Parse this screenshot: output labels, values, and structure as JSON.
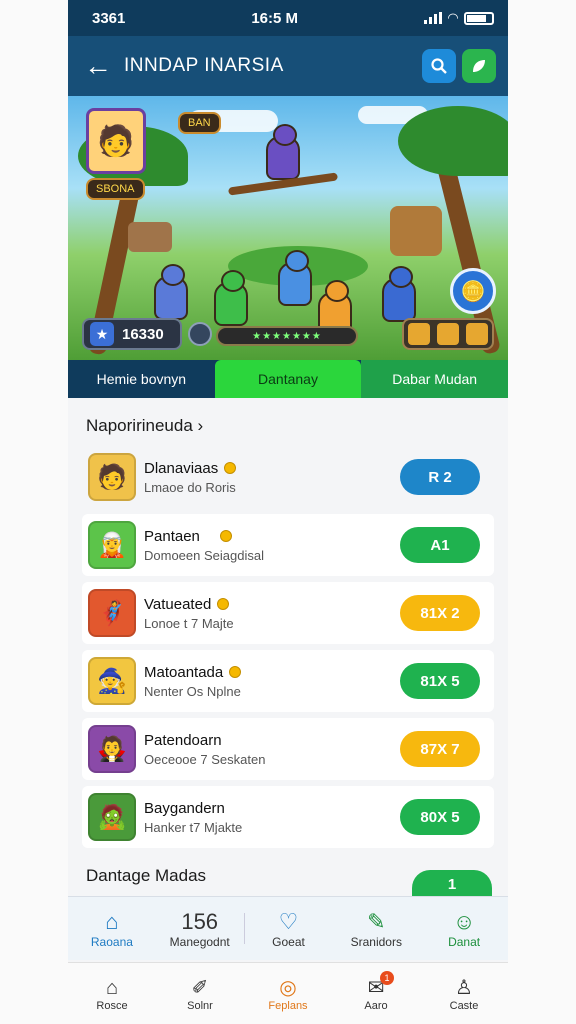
{
  "status": {
    "left": "3361",
    "time": "16:5 M"
  },
  "appbar": {
    "title": "INNDAP INARSIA"
  },
  "hero": {
    "hud_tag": "BAN",
    "name_tag": "SBONA",
    "score": "16330",
    "progress_text": "★★★★★★★"
  },
  "tabs": [
    {
      "label": "Hemie bovnyn"
    },
    {
      "label": "Dantanay"
    },
    {
      "label": "Dabar Mudan"
    }
  ],
  "section_title": "Naporirineuda ›",
  "rows": [
    {
      "name": "Dlanaviaas",
      "sub": "Lmaoe do Roris",
      "action": "R 2",
      "color": "blue",
      "icon": "🧑"
    },
    {
      "name": "Pantaen",
      "sub": "Domoeen Seiagdisal",
      "action": "A1",
      "color": "green",
      "icon": "🧝"
    },
    {
      "name": "Vatueated",
      "sub": "Lonoe t 7 Majte",
      "action": "81X 2",
      "color": "yellow",
      "icon": "🦸"
    },
    {
      "name": "Matoantada",
      "sub": "Nenter Os Nplne",
      "action": "81X 5",
      "color": "green",
      "icon": "🧙"
    },
    {
      "name": "Patendoarn",
      "sub": "Oeceooe 7 Seskaten",
      "action": "87X 7",
      "color": "yellow",
      "icon": "🧛"
    },
    {
      "name": "Baygandern",
      "sub": "Hanker t7 Mjakte",
      "action": "80X 5",
      "color": "green",
      "icon": "🧟"
    }
  ],
  "section2_title": "Dantage Madas",
  "peek_label": "1",
  "nav_top": [
    {
      "label": "Raoana",
      "icon": "⌂"
    },
    {
      "label": "Manegodnt",
      "icon": "156"
    },
    {
      "label": "Goeat",
      "icon": "♡"
    },
    {
      "label": "Sranidors",
      "icon": "✎"
    },
    {
      "label": "Danat",
      "icon": "☺"
    }
  ],
  "nav_bottom": [
    {
      "label": "Rosce",
      "icon": "⌂"
    },
    {
      "label": "Solnr",
      "icon": "✐"
    },
    {
      "label": "Feplans",
      "icon": "◎"
    },
    {
      "label": "Aaro",
      "icon": "✉",
      "badge": "1"
    },
    {
      "label": "Caste",
      "icon": "♙"
    }
  ],
  "colors": {
    "appbar": "#174f78",
    "accent_green": "#2bd63c",
    "accent_blue": "#1e86c9",
    "accent_yellow": "#f7b80e"
  }
}
